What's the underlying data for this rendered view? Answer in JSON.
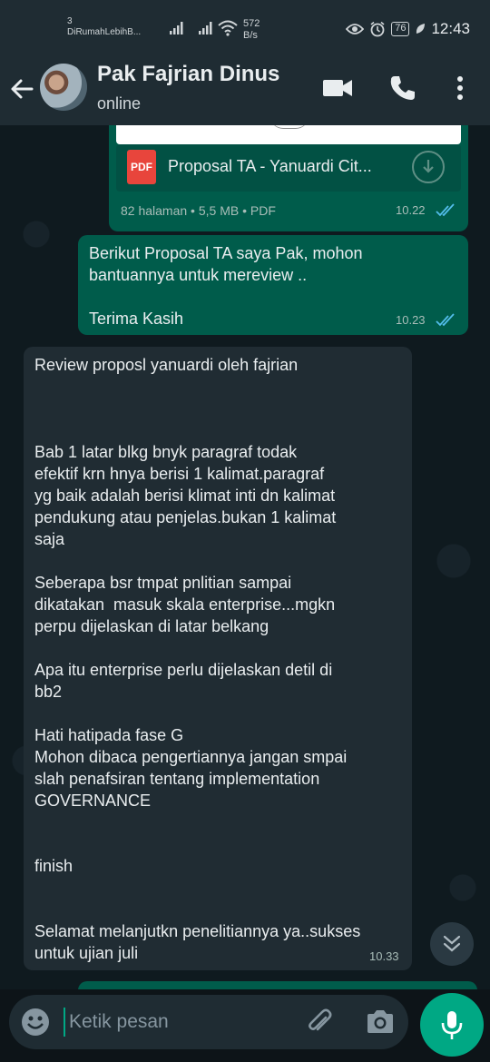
{
  "status_bar": {
    "carrier_count": "3",
    "carrier_name": "DiRumahLebihB...",
    "speed_value": "572",
    "speed_unit": "B/s",
    "battery": "76",
    "time": "12:43"
  },
  "header": {
    "contact_name": "Pak Fajrian Dinus",
    "status": "online",
    "icons": [
      "back-arrow-icon",
      "video-call-icon",
      "phone-icon",
      "more-vert-icon"
    ]
  },
  "messages": [
    {
      "type": "document",
      "direction": "outgoing",
      "file_icon_label": "PDF",
      "file_name": "Proposal TA - Yanuardi Cit...",
      "meta": "82 halaman • 5,5 MB • PDF",
      "time": "10.22",
      "status": "read"
    },
    {
      "type": "text",
      "direction": "outgoing",
      "text": "Berikut Proposal TA saya Pak, mohon\nbantuannya untuk mereview ..\n\nTerima Kasih",
      "time": "10.23",
      "status": "read"
    },
    {
      "type": "text",
      "direction": "incoming",
      "text": "Review proposl yanuardi oleh fajrian\n\n\n\nBab 1 latar blkg bnyk paragraf todak\nefektif krn hnya berisi 1 kalimat.paragraf\nyg baik adalah berisi klimat inti dn kalimat\npendukung atau penjelas.bukan 1 kalimat\nsaja\n\nSeberapa bsr tmpat pnlitian sampai\ndikatakan  masuk skala enterprise...mgkn\nperpu dijelaskan di latar belkang\n\nApa itu enterprise perlu dijelaskan detil di\nbb2\n\nHati hatipada fase G\nMohon dibaca pengertiannya jangan smpai\nslah penafsiran tentang implementation\nGOVERNANCE\n\n\nfinish\n\n\nSelamat melanjutkn penelitiannya ya..sukses\nuntuk ujian juli",
      "time": "10.33"
    }
  ],
  "composer": {
    "placeholder": "Ketik pesan",
    "value": ""
  },
  "colors": {
    "outgoing_bubble": "#005c4b",
    "incoming_bubble": "#202c33",
    "accent": "#00a884",
    "read_ticks": "#53bdeb"
  }
}
